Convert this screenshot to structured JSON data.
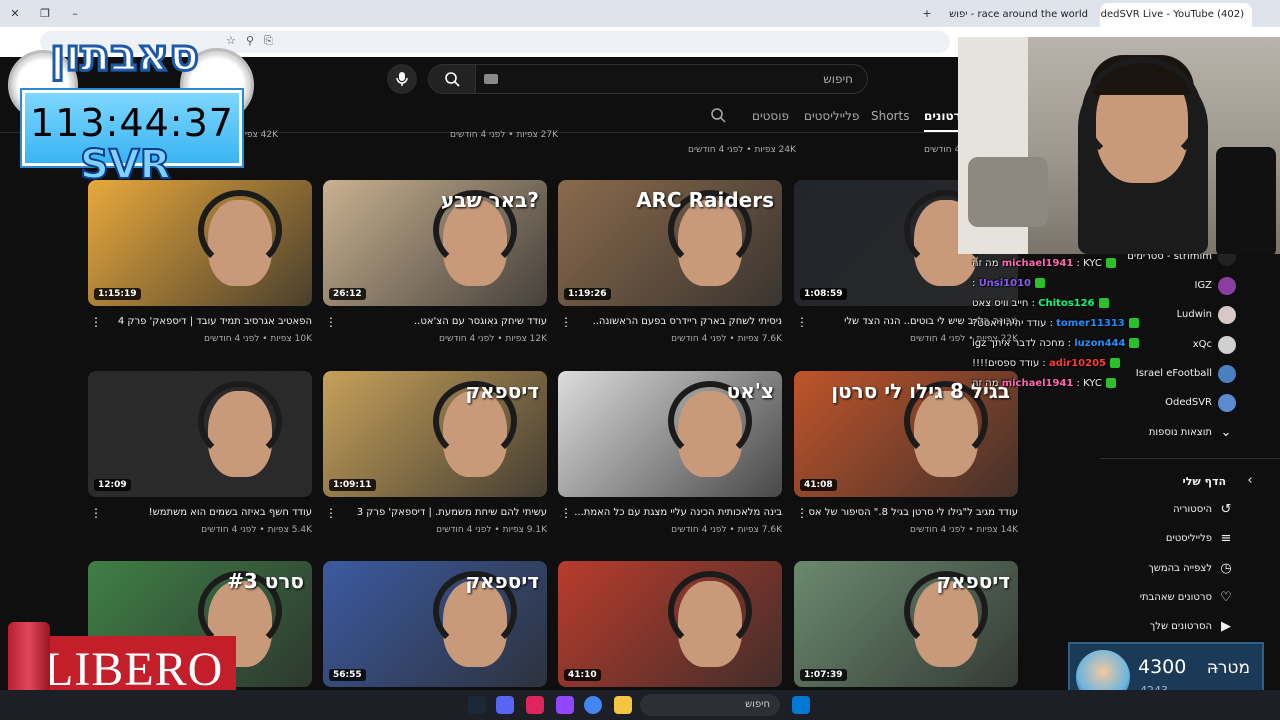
{
  "browser": {
    "tabs": [
      {
        "title": "race around the world - יפוש ב"
      },
      {
        "title": "(402) OdedSVR Live - YouTube"
      }
    ]
  },
  "youtube": {
    "search_placeholder": "חיפוש",
    "channel_tabs": [
      "סרטונים",
      "Shorts",
      "פלייליסטים",
      "פוסטים"
    ],
    "top_row": [
      {
        "meta": "42K צפיות • לפני 4 חודשים"
      },
      {
        "meta": "27K צפיות • לפני 4 חודשים"
      },
      {
        "meta": "24K צפיות • לפני 4 חודשים"
      },
      {
        "meta": "לפני 4 חודשים"
      }
    ],
    "videos": [
      {
        "title": "הפאטיב אגרסיב תמיד עובד | דיספאק' פרק 4",
        "meta": "10K צפיות • לפני 4 חודשים",
        "duration": "1:15:19",
        "thumb_text": "",
        "bg": "#e8a93c"
      },
      {
        "title": "עודד שיחק גאוגסר עם הצ'אט..",
        "meta": "12K צפיות • לפני 4 חודשים",
        "duration": "26:12",
        "thumb_text": "באר שבע?",
        "bg": "#c9b190"
      },
      {
        "title": "ניסיתי לשחק בארק ריידרס בפעם הראשונה..",
        "meta": "7.6K צפיות • לפני 4 חודשים",
        "duration": "1:19:26",
        "thumb_text": "ARC Raiders",
        "bg": "#8a6a4c"
      },
      {
        "title": "מכונה בלייב שיש לי בוטים.. הנה הצד שלי",
        "meta": "22K צפיות • לפני 4 חודשים",
        "duration": "1:08:59",
        "thumb_text": "",
        "bg": "#22252b"
      },
      {
        "title": "עודד חשף באיזה בשמים הוא משתמש!",
        "meta": "5.4K צפיות • לפני 4 חודשים",
        "duration": "12:09",
        "thumb_text": "",
        "bg": "#2b2b2b"
      },
      {
        "title": "עשיתי להם שיחת משמעת. | דיספאק' פרק 3",
        "meta": "9.1K צפיות • לפני 4 חודשים",
        "duration": "1:09:11",
        "thumb_text": "דיספאק",
        "bg": "#c7a15a"
      },
      {
        "title": "בינה מלאכותית הכינה עליי מצגת עם כל האמת...",
        "meta": "7.6K צפיות • לפני 4 חודשים",
        "duration": "",
        "thumb_text": "צ'אט",
        "bg": "#dcdcdc"
      },
      {
        "title": "עודד מגיב ל\"גילו לי סרטן בגיל 8.\" הסיפור של אסטרי",
        "meta": "14K צפיות • לפני 4 חודשים",
        "duration": "41:08",
        "thumb_text": "בגיל 8 גילו לי סרטן",
        "bg": "#c0542a"
      },
      {
        "title": "",
        "meta": "",
        "duration": "",
        "thumb_text": "סרט #3",
        "bg": "#3f7f46"
      },
      {
        "title": "",
        "meta": "",
        "duration": "56:55",
        "thumb_text": "דיספאק",
        "bg": "#3b5aa0"
      },
      {
        "title": "",
        "meta": "",
        "duration": "41:10",
        "thumb_text": "",
        "bg": "#b93c2c"
      },
      {
        "title": "",
        "meta": "",
        "duration": "1:07:39",
        "thumb_text": "דיספאק",
        "bg": "#6a8a6e"
      }
    ]
  },
  "sidebar": {
    "subscriptions": [
      {
        "label": "strimim - סטרימים",
        "color": "#222"
      },
      {
        "label": "IGZ",
        "color": "#8a3fa0"
      },
      {
        "label": "Ludwin",
        "color": "#d8c7c7"
      },
      {
        "label": "xQc",
        "color": "#cfcfcf"
      },
      {
        "label": "Israel eFootball",
        "color": "#4a7fc0"
      },
      {
        "label": "OdedSVR",
        "color": "#5a8ad0"
      }
    ],
    "show_more": "תוצאות נוספות",
    "you_header": "הדף שלי",
    "you_items": [
      {
        "label": "היסטוריה",
        "icon": "history-icon",
        "glyph": "↺"
      },
      {
        "label": "פלייליסטים",
        "icon": "playlists-icon",
        "glyph": "≡"
      },
      {
        "label": "לצפייה בהמשך",
        "icon": "clock-icon",
        "glyph": "◷"
      },
      {
        "label": "סרטונים שאהבתי",
        "icon": "like-icon",
        "glyph": "👍"
      },
      {
        "label": "הסרטונים שלך",
        "icon": "your-videos-icon",
        "glyph": "▶"
      }
    ]
  },
  "overlay": {
    "logo_text": "סאבתון",
    "timer": "113:44:37",
    "svr": "SVR",
    "chat": [
      {
        "user": "michael1941",
        "msg": "KYC מה זה",
        "color": "#ff69b4"
      },
      {
        "user": "Unsi1010",
        "msg": "",
        "color": "#8a5cf6"
      },
      {
        "user": "Chitos126",
        "msg": "חייב וויס צאט",
        "color": "#00ff7f"
      },
      {
        "user": "tomer11313",
        "msg": "עודד יהיה ראסט?",
        "color": "#1e90ff"
      },
      {
        "user": "luzon444",
        "msg": "מחכה לדבר איתך igz",
        "color": "#1e90ff"
      },
      {
        "user": "adir10205",
        "msg": "עודד ספסים!!!!",
        "color": "#ff3b3b"
      },
      {
        "user": "michael1941",
        "msg": "KYC מה זה",
        "color": "#ff69b4"
      }
    ],
    "libero": "LIBERO",
    "goal_label": "מטרה",
    "goal_target": "4300",
    "goal_current": "4243"
  },
  "taskbar": {
    "search_placeholder": "חיפוש"
  }
}
